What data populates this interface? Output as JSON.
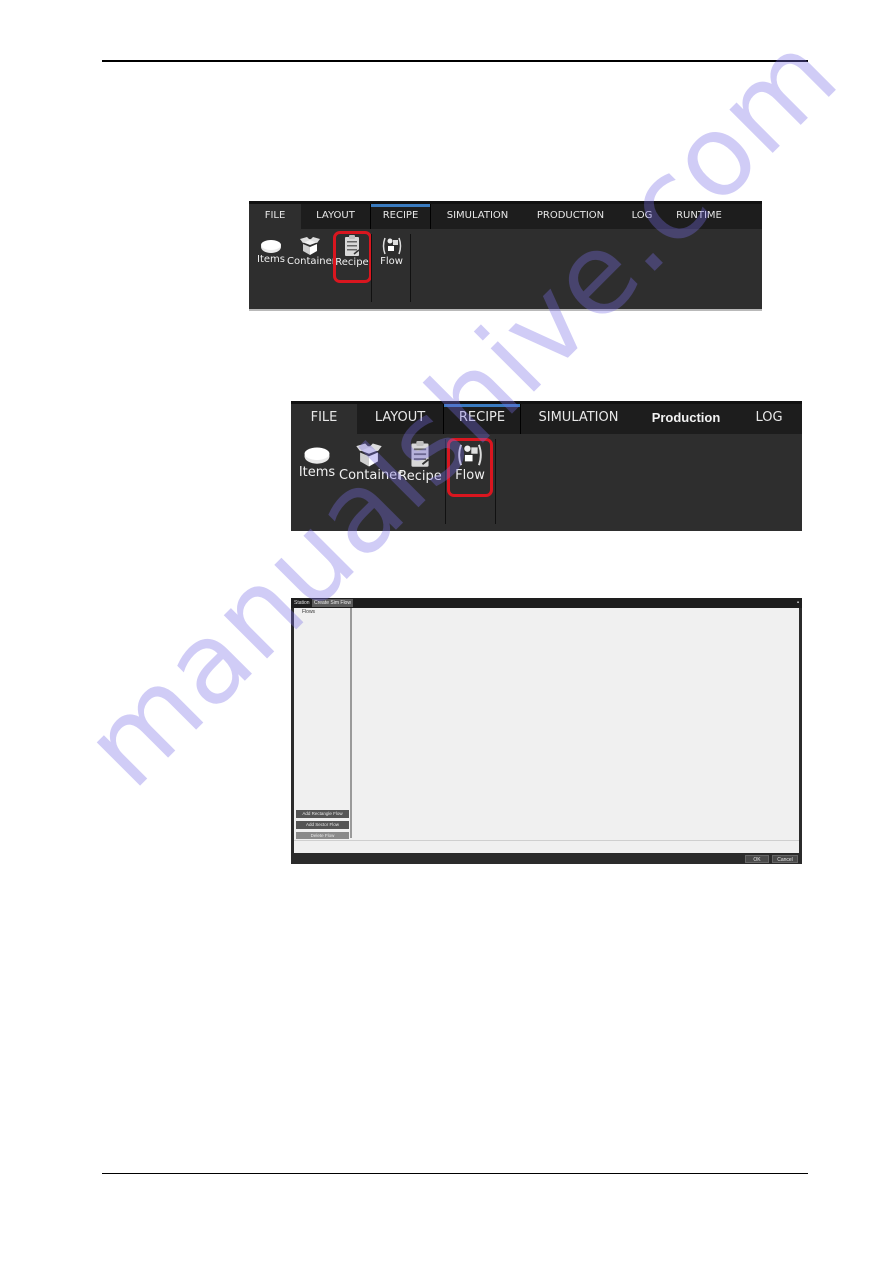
{
  "ribbon1": {
    "tabs": [
      "FILE",
      "LAYOUT",
      "RECIPE",
      "SIMULATION",
      "PRODUCTION",
      "LOG",
      "RUNTIME"
    ],
    "active_tab": "RECIPE",
    "tools": [
      {
        "label": "Items",
        "icon": "items-disc-icon"
      },
      {
        "label": "Container",
        "icon": "container-box-icon"
      },
      {
        "label": "Recipe",
        "icon": "recipe-clipboard-icon"
      },
      {
        "label": "Flow",
        "icon": "flow-icon"
      }
    ],
    "highlighted_tool": "Recipe",
    "highlight_color": "#d9161f",
    "accent_color": "#3a7bbf"
  },
  "ribbon2": {
    "tabs": [
      "FILE",
      "LAYOUT",
      "RECIPE",
      "SIMULATION",
      "Production",
      "LOG"
    ],
    "active_tab": "RECIPE",
    "tools": [
      {
        "label": "Items",
        "icon": "items-disc-icon"
      },
      {
        "label": "Container",
        "icon": "container-box-icon"
      },
      {
        "label": "Recipe",
        "icon": "recipe-clipboard-icon"
      },
      {
        "label": "Flow",
        "icon": "flow-icon"
      }
    ],
    "highlighted_tool": "Flow",
    "highlight_color": "#d9161f"
  },
  "dialog": {
    "title_prefix": "Station",
    "title_tab": "Create Sim Flow",
    "close_glyph": "▪",
    "list_header": "Flows",
    "buttons": [
      "Add Rectangle Flow",
      "Add Sector Flow",
      "Delete Flow"
    ],
    "ok_label": "OK",
    "cancel_label": "Cancel"
  },
  "watermark": "manualshive.com"
}
